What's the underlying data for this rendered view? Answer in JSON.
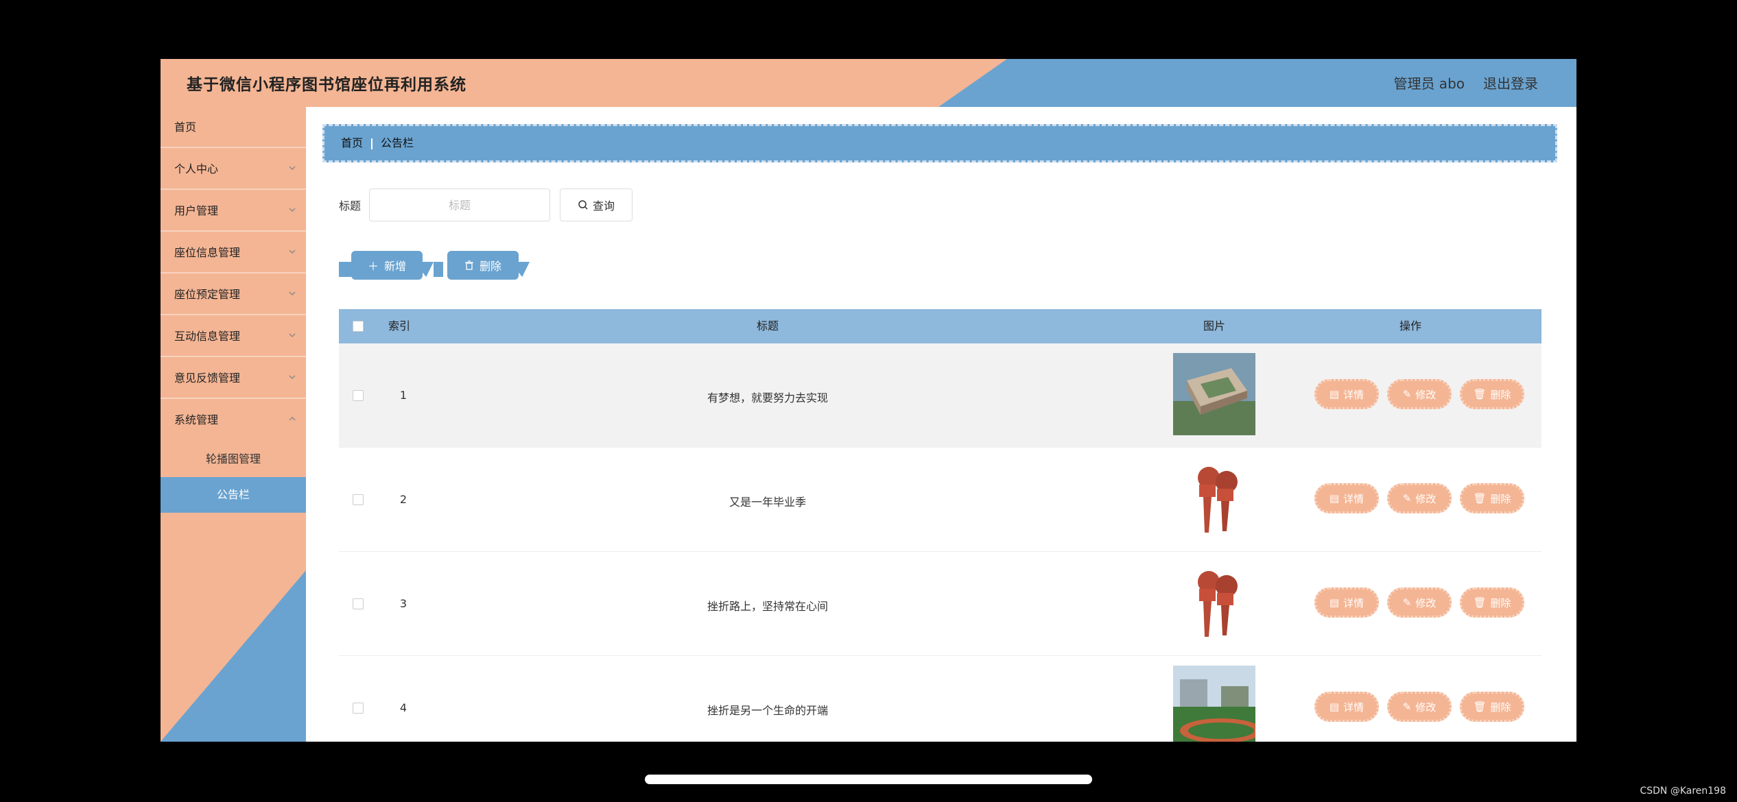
{
  "header": {
    "title": "基于微信小程序图书馆座位再利用系统",
    "admin": "管理员 abo",
    "logout": "退出登录"
  },
  "sidebar": {
    "items": [
      {
        "label": "首页"
      },
      {
        "label": "个人中心"
      },
      {
        "label": "用户管理"
      },
      {
        "label": "座位信息管理"
      },
      {
        "label": "座位预定管理"
      },
      {
        "label": "互动信息管理"
      },
      {
        "label": "意见反馈管理"
      },
      {
        "label": "系统管理"
      }
    ],
    "subitems": [
      {
        "label": "轮播图管理"
      },
      {
        "label": "公告栏"
      }
    ]
  },
  "breadcrumb": {
    "home": "首页",
    "current": "公告栏"
  },
  "search": {
    "label": "标题",
    "placeholder": "标题",
    "button": "查询"
  },
  "toolbar": {
    "add": "新增",
    "delete": "删除"
  },
  "table": {
    "headers": {
      "index": "索引",
      "title": "标题",
      "image": "图片",
      "actions": "操作"
    },
    "action_labels": {
      "detail": "详情",
      "edit": "修改",
      "delete": "删除"
    },
    "rows": [
      {
        "index": "1",
        "title": "有梦想，就要努力去实现",
        "image": "campus-aerial"
      },
      {
        "index": "2",
        "title": "又是一年毕业季",
        "image": "news-microphones"
      },
      {
        "index": "3",
        "title": "挫折路上，坚持常在心间",
        "image": "news-microphones"
      },
      {
        "index": "4",
        "title": "挫折是另一个生命的开端",
        "image": "sports-field"
      }
    ]
  },
  "credit": "CSDN @Karen198",
  "colors": {
    "peach": "#F4B594",
    "blue": "#6AA3D0",
    "header_blue": "#8EB8DC"
  }
}
